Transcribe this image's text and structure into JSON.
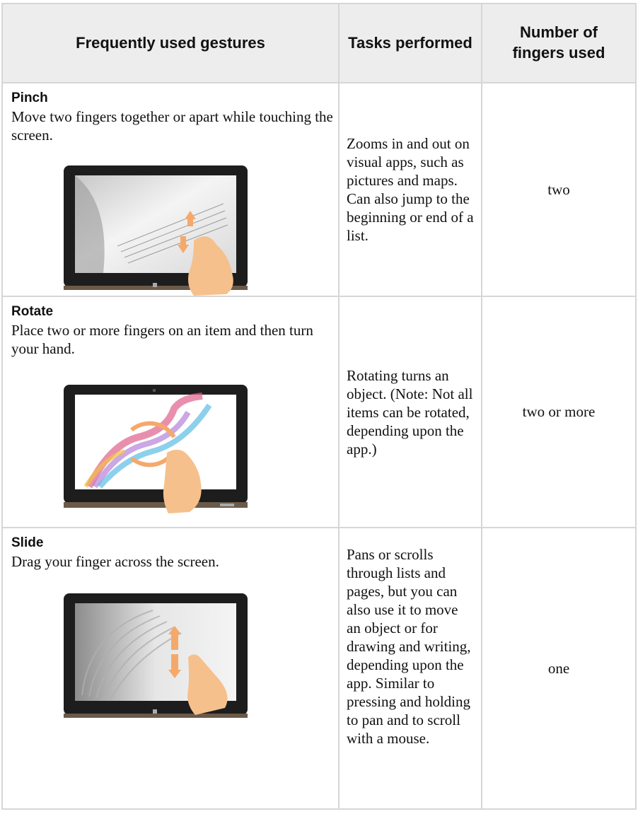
{
  "table": {
    "headers": {
      "gestures": "Frequently used gestures",
      "tasks": "Tasks performed",
      "fingers": "Number of fingers used"
    },
    "rows": [
      {
        "name": "Pinch",
        "description": "Move two fingers together or apart while touching the screen.",
        "task": "Zooms in and out on visual apps, such as pictures and maps. Can also jump to the beginning or end of a list.",
        "fingers": "two"
      },
      {
        "name": "Rotate",
        "description": "Place two or more fingers on an item and then turn your hand.",
        "task": "Rotating turns an object. (Note: Not all items can be rotated, depending upon the app.)",
        "fingers": "two or more"
      },
      {
        "name": "Slide",
        "description": "Drag your finger across the screen.",
        "task": "Pans or scrolls through lists and pages, but you can also use it to move an object or for drawing and writing, depending upon the app. Similar to pressing and holding to pan and to scroll with a mouse.",
        "fingers": "one"
      }
    ]
  },
  "colors": {
    "border": "#d6d6d6",
    "header_bg": "#ededed",
    "arrow": "#f4a96b",
    "hand": "#f6c08c"
  },
  "illustrations": {
    "pinch": "tablet-pinch-gesture-image",
    "rotate": "tablet-rotate-gesture-image",
    "slide": "tablet-slide-gesture-image"
  }
}
